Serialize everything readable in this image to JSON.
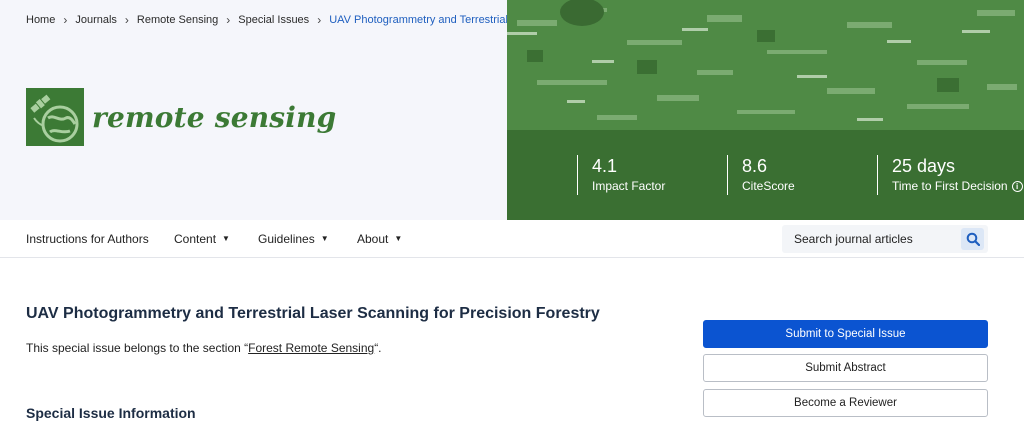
{
  "breadcrumb": {
    "items": [
      "Home",
      "Journals",
      "Remote Sensing",
      "Special Issues",
      "UAV Photogrammetry and Terrestrial..."
    ],
    "separator": "›"
  },
  "journal": {
    "name": "remote sensing",
    "logo_icon": "satellite-globe-icon"
  },
  "stats": [
    {
      "value": "4.1",
      "label": "Impact Factor"
    },
    {
      "value": "8.6",
      "label": "CiteScore"
    },
    {
      "value": "25 days",
      "label": "Time to First Decision",
      "info_icon": "info-icon"
    }
  ],
  "nav": {
    "items": [
      {
        "label": "Instructions for Authors"
      },
      {
        "label": "Content"
      },
      {
        "label": "Guidelines"
      },
      {
        "label": "About"
      }
    ]
  },
  "search": {
    "placeholder": "Search journal articles",
    "icon": "search-icon"
  },
  "content": {
    "title": "UAV Photogrammetry and Terrestrial Laser Scanning for Precision Forestry",
    "section_prefix": "This special issue belongs to the section “",
    "section_link": "Forest Remote Sensing",
    "section_suffix": "“.",
    "subheading": "Special Issue Information"
  },
  "actions": {
    "submit": "Submit to Special Issue",
    "abstract": "Submit Abstract",
    "reviewer": "Become a Reviewer"
  },
  "colors": {
    "brand_green": "#3c7a35",
    "primary_blue": "#0b54d1",
    "link_blue": "#1f5fbf",
    "title_navy": "#1d2d44"
  }
}
